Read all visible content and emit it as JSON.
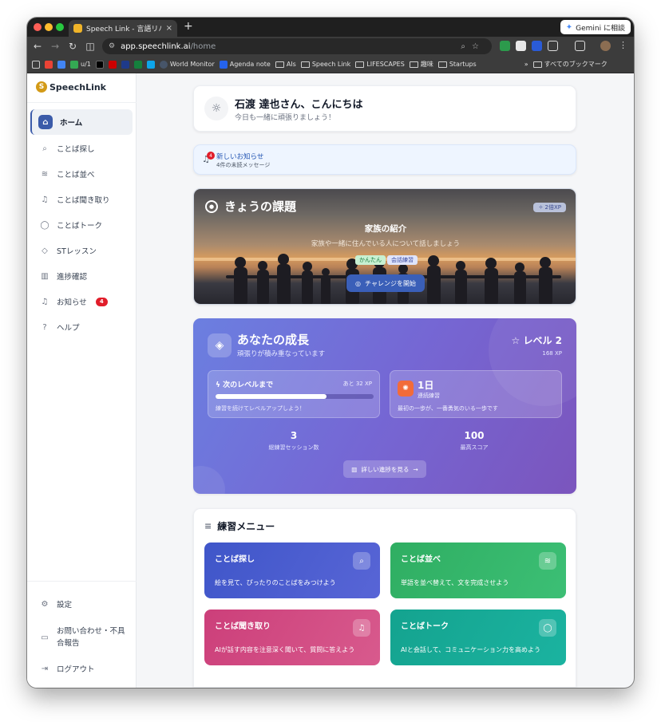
{
  "browser": {
    "tab_title": "Speech Link - 言語リハビリ支援",
    "tab_close": "×",
    "new_tab": "+",
    "gemini_label": "Gemini に相談",
    "url_host": "app.speechlink.ai",
    "url_path": "/home",
    "bookmarks": [
      "u/1",
      "World Monitor",
      "Agenda note",
      "AIs",
      "Speech Link",
      "LIFESCAPES",
      "趣味",
      "Startups"
    ],
    "bookmarks_overflow": "»",
    "all_bookmarks": "すべてのブックマーク"
  },
  "sidebar": {
    "logo": "SpeechLink",
    "items": [
      {
        "label": "ホーム",
        "icon": "home-icon"
      },
      {
        "label": "ことば探し",
        "icon": "search-icon"
      },
      {
        "label": "ことば並べ",
        "icon": "layers-icon"
      },
      {
        "label": "ことば聞き取り",
        "icon": "headphones-icon"
      },
      {
        "label": "ことばトーク",
        "icon": "chat-icon"
      },
      {
        "label": "STレッスン",
        "icon": "graduation-icon"
      },
      {
        "label": "進捗確認",
        "icon": "bar-chart-icon"
      },
      {
        "label": "お知らせ",
        "icon": "bell-icon",
        "badge": "4"
      },
      {
        "label": "ヘルプ",
        "icon": "help-icon"
      }
    ],
    "bottom": [
      {
        "label": "設定",
        "icon": "gear-icon"
      },
      {
        "label": "お問い合わせ・不具合報告",
        "icon": "feedback-icon"
      },
      {
        "label": "ログアウト",
        "icon": "logout-icon"
      }
    ]
  },
  "greeting": {
    "title": "石渡 達也さん、こんにちは",
    "subtitle": "今日も一緒に頑張りましょう！"
  },
  "notice": {
    "count": "4",
    "title": "新しいお知らせ",
    "subtitle": "4件の未読メッセージ"
  },
  "challenge": {
    "heading": "きょうの課題",
    "xp_chip": "✧ 2倍XP",
    "title": "家族の紹介",
    "description": "家族や一緒に住んでいる人について話しましょう",
    "tags": [
      "かんたん",
      "会話練習"
    ],
    "button": "チャレンジを開始"
  },
  "growth": {
    "title": "あなたの成長",
    "subtitle": "頑張りが積み重なっています",
    "level": "レベル 2",
    "xp": "168 XP",
    "next_level_label": "次のレベルまで",
    "next_level_remaining": "あと 32 XP",
    "progress": 0.7,
    "progress_note": "練習を続けてレベルアップしよう！",
    "streak_value": "1日",
    "streak_label": "連続練習",
    "streak_note": "最初の一歩が、一番勇気のいる一歩です",
    "sessions_value": "3",
    "sessions_label": "総練習セッション数",
    "best_value": "100",
    "best_label": "最高スコア",
    "detail_button": "詳しい進捗を見る"
  },
  "menu": {
    "title": "練習メニュー",
    "cards": [
      {
        "title": "ことば探し",
        "desc": "絵を見て、ぴったりのことばをみつけよう",
        "icon": "search-icon"
      },
      {
        "title": "ことば並べ",
        "desc": "単語を並べ替えて、文を完成させよう",
        "icon": "layers-icon"
      },
      {
        "title": "ことば聞き取り",
        "desc": "AIが話す内容を注意深く聞いて、質問に答えよう",
        "icon": "headphones-icon"
      },
      {
        "title": "ことばトーク",
        "desc": "AIと会話して、コミュニケーション力を高めよう",
        "icon": "chat-icon"
      }
    ]
  },
  "colors": {
    "accent": "#3b5ba9",
    "growth_gradient": [
      "#6b7fe0",
      "#7b55bd"
    ],
    "card_search": "#4a5ccf",
    "card_order": "#34b56b",
    "card_listen": "#d24f85",
    "card_talk": "#17ab97"
  }
}
